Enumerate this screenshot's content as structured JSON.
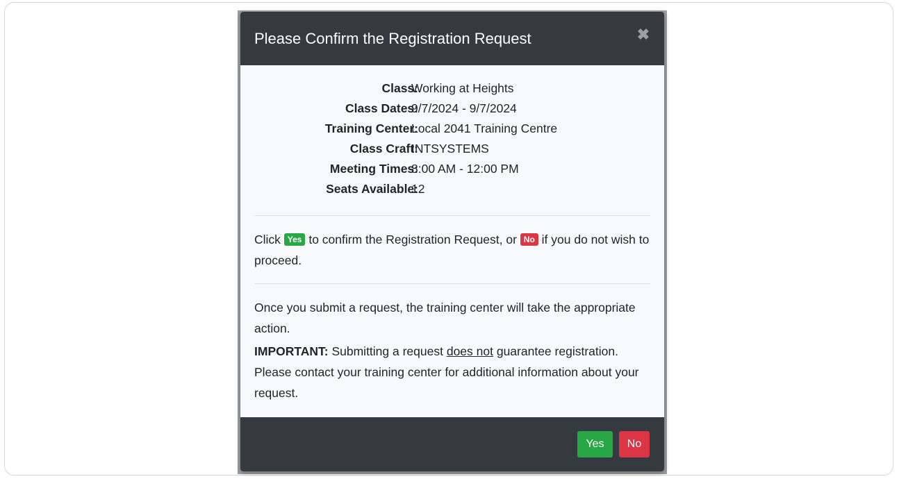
{
  "modal": {
    "title": "Please Confirm the Registration Request",
    "close_glyph": "✖"
  },
  "details": [
    {
      "label": "Class:",
      "value": "Working at Heights"
    },
    {
      "label": "Class Dates:",
      "value": "9/7/2024 - 9/7/2024"
    },
    {
      "label": "Training Center:",
      "value": "Local 2041 Training Centre"
    },
    {
      "label": "Class Craft:",
      "value": "INTSYSTEMS"
    },
    {
      "label": "Meeting Times:",
      "value": "8:00 AM - 12:00 PM"
    },
    {
      "label": "Seats Available:",
      "value": "12"
    }
  ],
  "instructions": {
    "prefix": "Click ",
    "yes_badge": "Yes",
    "middle": " to confirm the Registration Request, or ",
    "no_badge": "No",
    "suffix": " if you do not wish to proceed."
  },
  "info": {
    "text": "Once you submit a request, the training center will take the appropriate action."
  },
  "important": {
    "label": "IMPORTANT:",
    "text_before": " Submitting a request ",
    "underlined": "does not",
    "text_after": " guarantee registration. Please contact your training center for additional information about your request."
  },
  "footer": {
    "yes_label": "Yes",
    "no_label": "No"
  },
  "colors": {
    "header_bg": "#343a40",
    "success": "#28a745",
    "danger": "#dc3545",
    "body_bg": "#f8f9fa"
  }
}
